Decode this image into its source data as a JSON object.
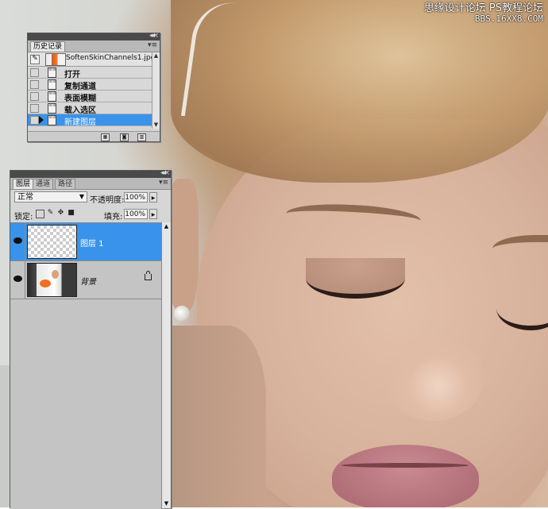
{
  "watermark": {
    "line1": "思缘设计论坛 PS教程论坛",
    "line2": "BBS.16XX8.COM"
  },
  "history": {
    "title_tab": "历史记录",
    "snapshot_label": "SoftenSkinChannels1.jpg",
    "items": [
      {
        "label": "打开"
      },
      {
        "label": "复制通道"
      },
      {
        "label": "表面模糊"
      },
      {
        "label": "载入选区"
      },
      {
        "label": "新建图层"
      }
    ]
  },
  "layers": {
    "tabs": [
      "图层",
      "通道",
      "路径"
    ],
    "blend_mode": "正常",
    "opacity_label": "不透明度:",
    "opacity_value": "100%",
    "lock_label": "锁定:",
    "fill_label": "填充:",
    "fill_value": "100%",
    "items": [
      {
        "name": "图层 1"
      },
      {
        "name": "背景"
      }
    ]
  }
}
